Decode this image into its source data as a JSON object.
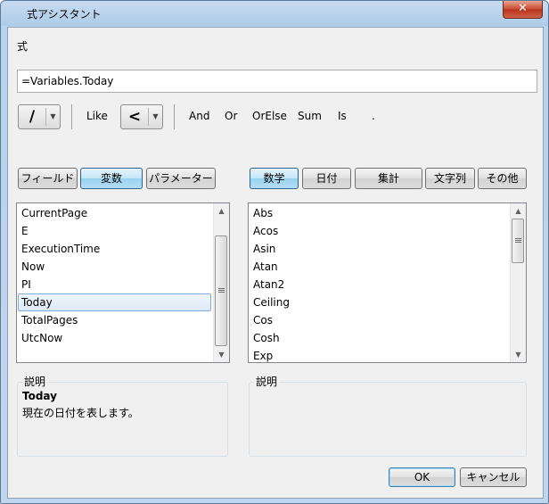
{
  "window": {
    "title": "式アシスタント",
    "close_glyph": "✕"
  },
  "formula": {
    "label": "式",
    "value": "=Variables.Today"
  },
  "operators": {
    "combo1_symbol": "/",
    "like": "Like",
    "combo2_symbol": "<",
    "and": "And",
    "or": "Or",
    "orelse": "OrElse",
    "sum": "Sum",
    "is": "Is",
    "dot": "."
  },
  "left_tabs": [
    "フィールド",
    "変数",
    "パラメーター"
  ],
  "left_selected_tab": "変数",
  "right_tabs": [
    "数学",
    "日付",
    "集計",
    "文字列",
    "その他"
  ],
  "right_selected_tab": "数学",
  "left_list": {
    "items": [
      "CurrentPage",
      "E",
      "ExecutionTime",
      "Now",
      "PI",
      "Today",
      "TotalPages",
      "UtcNow"
    ],
    "selected": "Today"
  },
  "right_list": {
    "items": [
      "Abs",
      "Acos",
      "Asin",
      "Atan",
      "Atan2",
      "Ceiling",
      "Cos",
      "Cosh",
      "Exp"
    ]
  },
  "description_left": {
    "title": "説明",
    "name": "Today",
    "text": "現在の日付を表します。"
  },
  "description_right": {
    "title": "説明"
  },
  "buttons": {
    "ok": "OK",
    "cancel": "キャンセル"
  }
}
